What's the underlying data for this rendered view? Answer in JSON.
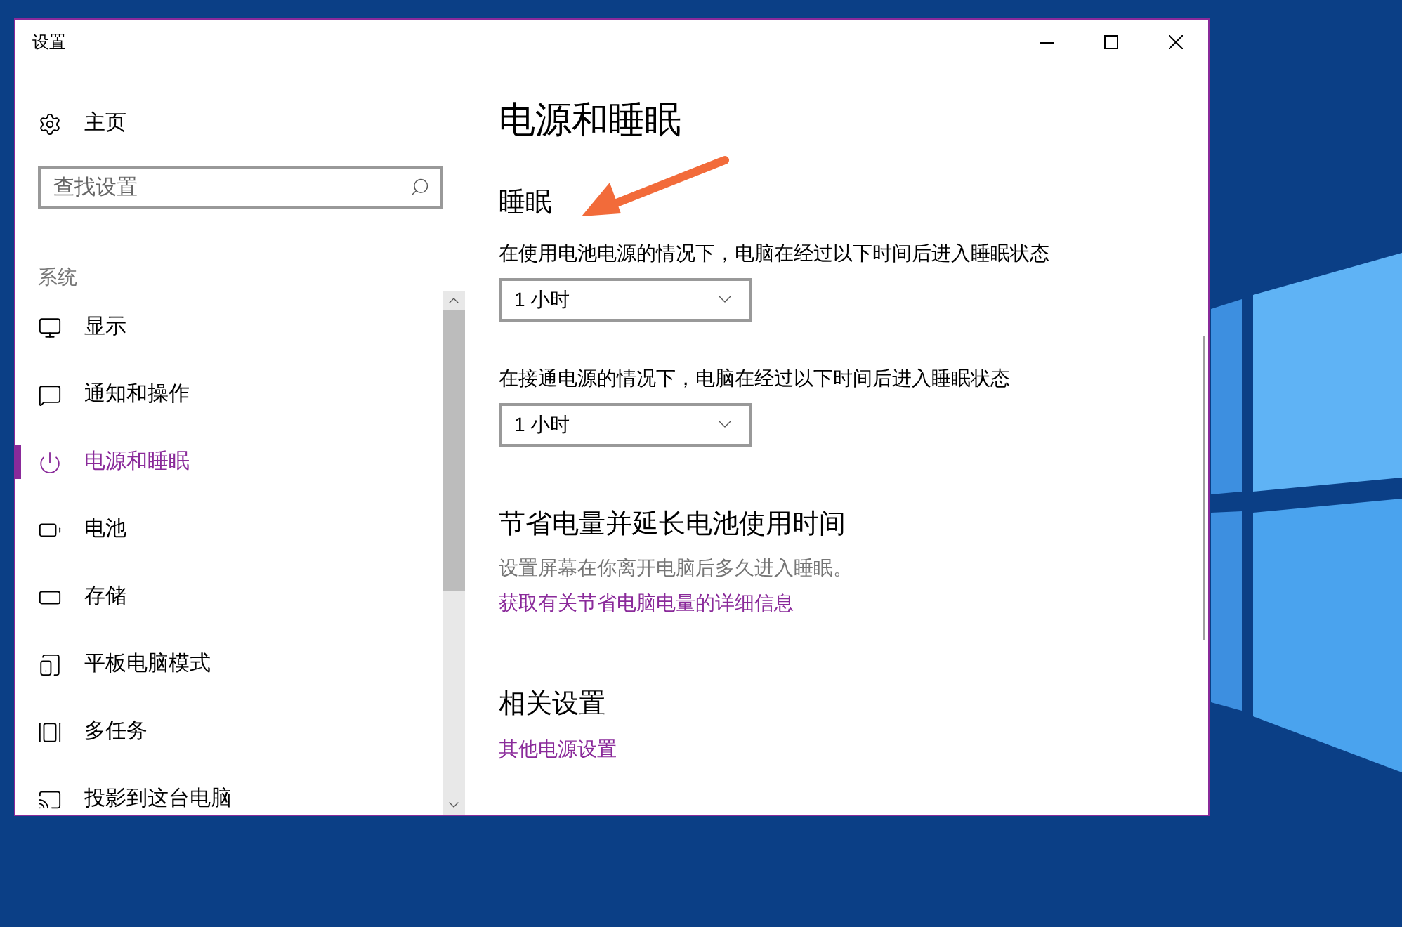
{
  "window": {
    "title": "设置"
  },
  "sidebar": {
    "home": "主页",
    "search": {
      "placeholder": "查找设置"
    },
    "section": "系统",
    "items": [
      {
        "label": "显示",
        "selected": false
      },
      {
        "label": "通知和操作",
        "selected": false
      },
      {
        "label": "电源和睡眠",
        "selected": true
      },
      {
        "label": "电池",
        "selected": false
      },
      {
        "label": "存储",
        "selected": false
      },
      {
        "label": "平板电脑模式",
        "selected": false
      },
      {
        "label": "多任务",
        "selected": false
      },
      {
        "label": "投影到这台电脑",
        "selected": false
      }
    ]
  },
  "page": {
    "title": "电源和睡眠",
    "sleep": {
      "heading": "睡眠",
      "settings": [
        {
          "label": "在使用电池电源的情况下，电脑在经过以下时间后进入睡眠状态",
          "value": "1 小时"
        },
        {
          "label": "在接通电源的情况下，电脑在经过以下时间后进入睡眠状态",
          "value": "1 小时"
        }
      ]
    },
    "save": {
      "heading": "节省电量并延长电池使用时间",
      "description": "设置屏幕在你离开电脑后多久进入睡眠。",
      "link": "获取有关节省电脑电量的详细信息"
    },
    "related": {
      "heading": "相关设置",
      "link": "其他电源设置"
    }
  }
}
